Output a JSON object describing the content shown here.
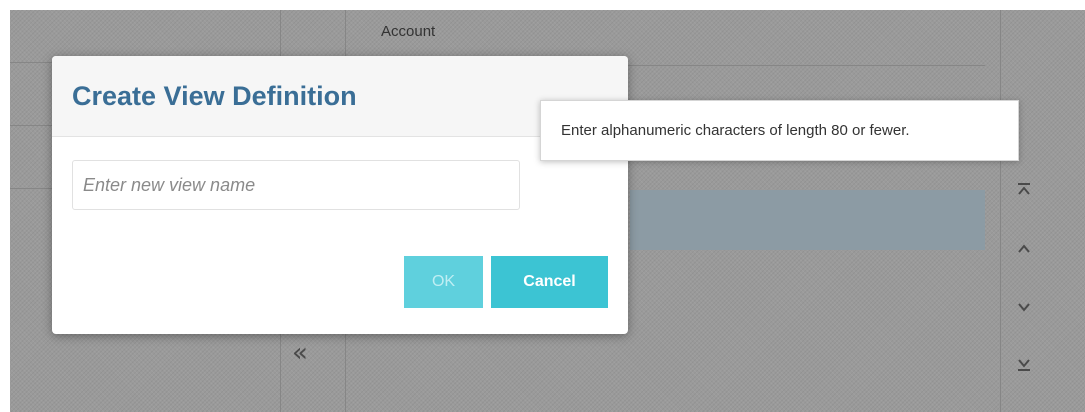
{
  "background": {
    "column_header": "Account",
    "move_left_icon": "double-chevron-left-icon",
    "reorder_buttons": [
      {
        "name": "move-to-top-button",
        "icon": "move-to-top-icon"
      },
      {
        "name": "move-up-button",
        "icon": "chevron-up-icon"
      },
      {
        "name": "move-down-button",
        "icon": "chevron-down-icon"
      },
      {
        "name": "move-to-bottom-button",
        "icon": "move-to-bottom-icon"
      }
    ]
  },
  "dialog": {
    "title": "Create View Definition",
    "name_input": {
      "value": "",
      "placeholder": "Enter new view name"
    },
    "ok_label": "OK",
    "cancel_label": "Cancel"
  },
  "tooltip": {
    "text": "Enter alphanumeric characters of length 80 or fewer."
  },
  "colors": {
    "title": "#3a6e96",
    "button_primary": "#3cc4d3",
    "button_disabled": "#5fd0dd",
    "overlay": "#9a9a9a"
  }
}
